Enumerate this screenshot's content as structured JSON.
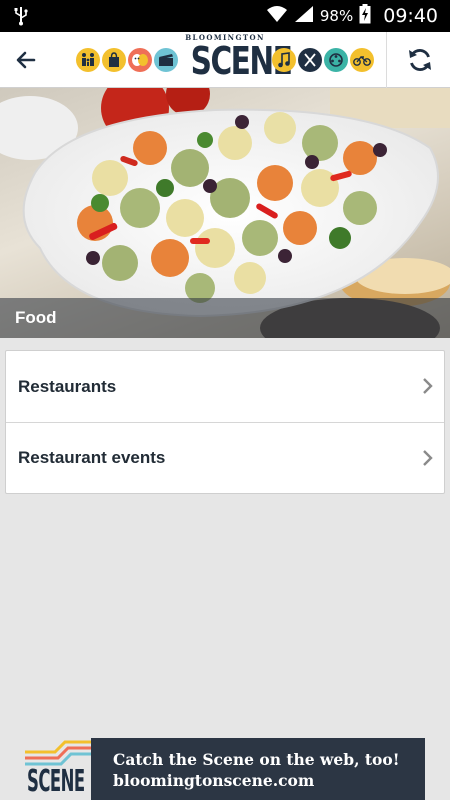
{
  "status_bar": {
    "battery_percent": "98%",
    "time": "09:40",
    "icons": [
      "usb-icon",
      "wifi-icon",
      "signal-icon",
      "battery-charging-icon"
    ]
  },
  "header": {
    "logo_small": "BLOOMINGTON",
    "logo_big": "SCENE",
    "category_icons": [
      "family-icon",
      "shopping-icon",
      "theater-icon",
      "film-icon",
      "music-icon",
      "dining-icon",
      "nightlife-icon",
      "cycling-icon"
    ],
    "accent_colors": {
      "blue": "#6fc3d4",
      "gold": "#f3c02d",
      "coral": "#ef6f57",
      "teal": "#3bb3a6",
      "navy": "#1f2f42"
    }
  },
  "hero": {
    "title": "Food"
  },
  "list": {
    "items": [
      {
        "label": "Restaurants"
      },
      {
        "label": "Restaurant events"
      }
    ]
  },
  "ad": {
    "line1": "Catch the Scene on the web, too!",
    "line2": "bloomingtonscene.com",
    "logo_text": "SCENE"
  }
}
